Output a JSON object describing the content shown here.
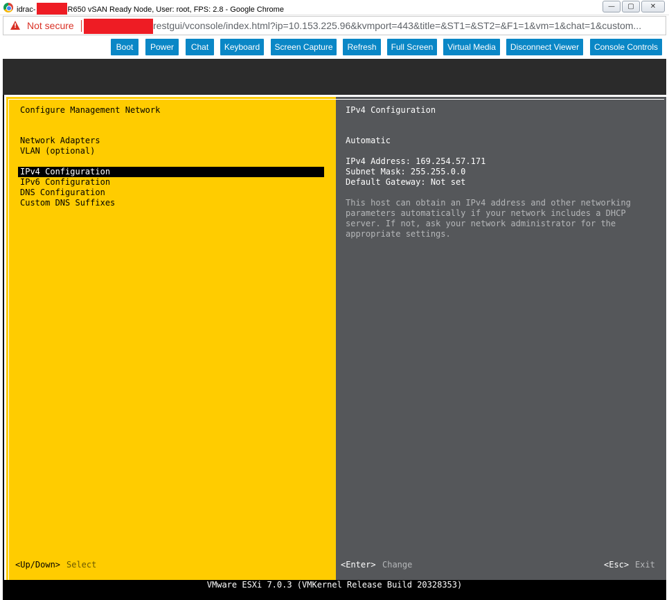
{
  "window": {
    "title_prefix": "idrac-",
    "title_suffix": "R650 vSAN Ready Node, User: root, FPS: 2.8 - Google Chrome",
    "minimize": "—",
    "maximize": "▢",
    "close": "✕"
  },
  "address": {
    "security_label": "Not secure",
    "url": "restgui/vconsole/index.html?ip=10.153.225.96&kvmport=443&title=&ST1=&ST2=&F1=1&vm=1&chat=1&custom..."
  },
  "toolbar": {
    "buttons": [
      "Boot",
      "Power",
      "Chat",
      "Keyboard",
      "Screen Capture",
      "Refresh",
      "Full Screen",
      "Virtual Media",
      "Disconnect Viewer",
      "Console Controls"
    ]
  },
  "colors": {
    "toolbar_button": "#0a87c6",
    "left_panel": "#ffcc00",
    "right_panel": "#55575a"
  },
  "console": {
    "left_title": "Configure Management Network",
    "menu": [
      "Network Adapters",
      "VLAN (optional)",
      "IPv4 Configuration",
      "IPv6 Configuration",
      "DNS Configuration",
      "Custom DNS Suffixes"
    ],
    "selected_item": "IPv4 Configuration",
    "right_title": "IPv4 Configuration",
    "mode": "Automatic",
    "ipv4_address": "IPv4 Address: 169.254.57.171",
    "subnet_mask": "Subnet Mask: 255.255.0.0",
    "default_gateway": "Default Gateway: Not set",
    "description": [
      "This host can obtain an IPv4 address and other networking",
      "parameters automatically if your network includes a DHCP",
      "server. If not, ask your network administrator for the",
      "appropriate settings."
    ],
    "footer": {
      "updown_key": "<Up/Down>",
      "updown_action": "Select",
      "enter_key": "<Enter>",
      "enter_action": "Change",
      "esc_key": "<Esc>",
      "esc_action": "Exit"
    },
    "status_line": "VMware ESXi 7.0.3 (VMKernel Release Build 20328353)"
  }
}
